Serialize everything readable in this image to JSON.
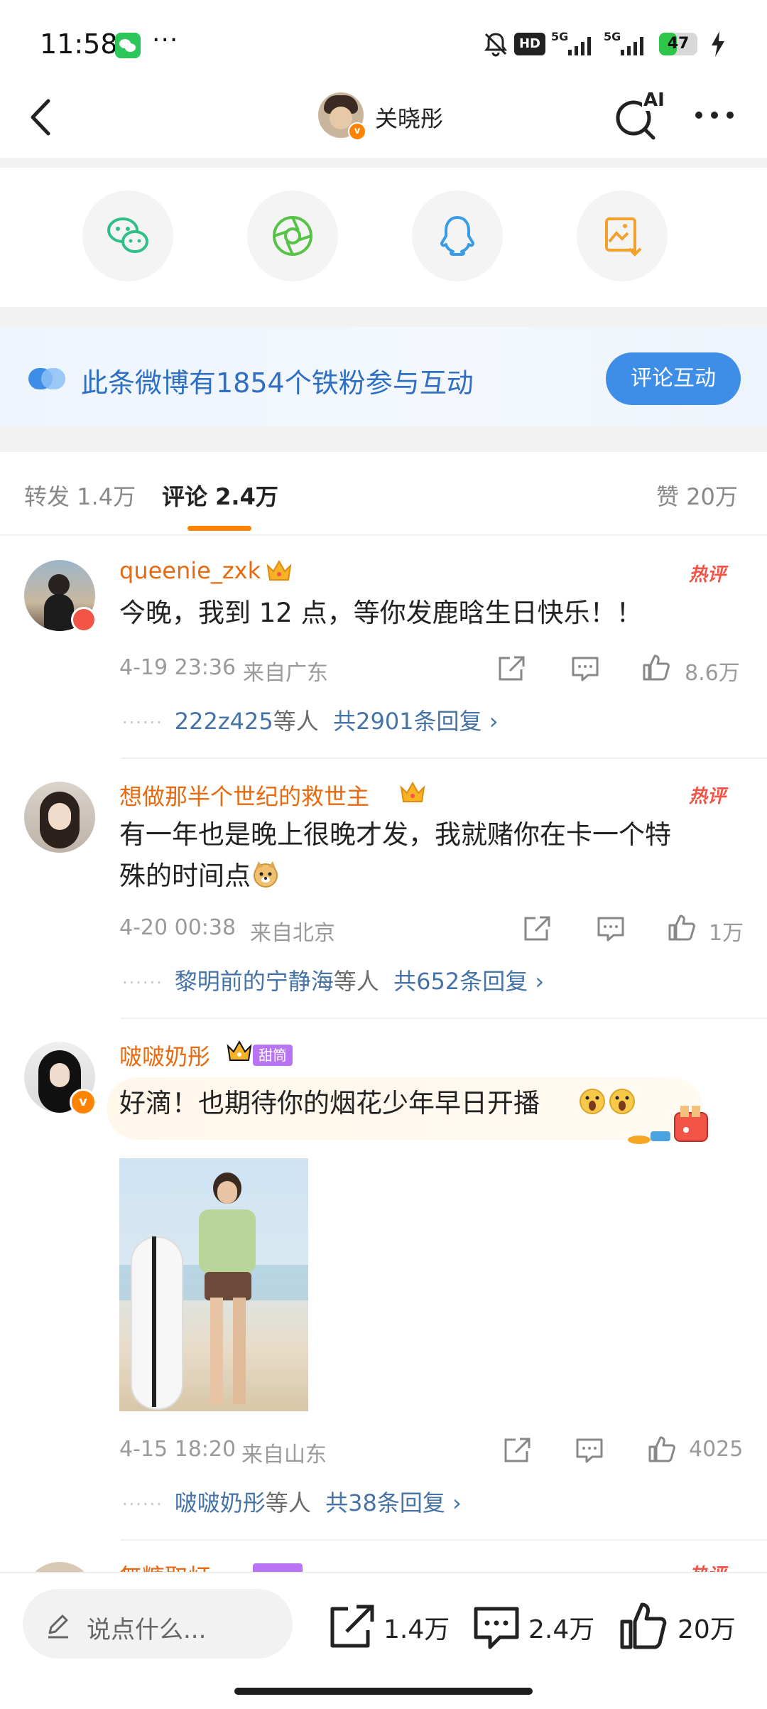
{
  "status_bar": {
    "time": "11:58",
    "more": "···",
    "hd": "HD",
    "signal_1": "5G",
    "signal_2": "5G",
    "battery_level": 47,
    "battery_text": "47"
  },
  "header": {
    "title": "关晓彤",
    "ai_label": "AI"
  },
  "share": {
    "icons": [
      "wechat-icon",
      "moments-icon",
      "qq-icon",
      "save-image-icon"
    ]
  },
  "banner": {
    "text": "此条微博有1854个铁粉参与互动",
    "button": "评论互动"
  },
  "tabs": {
    "repost": "转发 1.4万",
    "comment": "评论 2.4万",
    "like": "赞 20万"
  },
  "comments": [
    {
      "user": "queenie_zxk",
      "hot": "热评",
      "text": "今晚，我到 12 点，等你发鹿晗生日快乐！！",
      "time": "4-19 23:36",
      "location": "来自广东",
      "likes": "8.6万",
      "reply_users": "222z425",
      "reply_mid": "等人",
      "reply_total": "共2901条回复 ›"
    },
    {
      "user": "想做那半个世纪的救世主",
      "hot": "热评",
      "text_line1": "有一年也是晚上很晚才发，我就赌你在卡一个特",
      "text_line2": "殊的时间点",
      "time": "4-20 00:38",
      "location": "来自北京",
      "likes": "1万",
      "reply_users": "黎明前的宁静海",
      "reply_mid": "等人",
      "reply_total": "共652条回复 ›"
    },
    {
      "user": "啵啵奶彤",
      "fan_badge": "甜筒",
      "text": "好滴！也期待你的烟花少年早日开播",
      "time": "4-15 18:20",
      "location": "来自山东",
      "likes": "4025",
      "reply_users": "啵啵奶彤",
      "reply_mid": "等人",
      "reply_total": "共38条回复 ›"
    },
    {
      "user": "無糖取灯",
      "hot": "热评"
    }
  ],
  "bottom_bar": {
    "placeholder": "说点什么...",
    "reposts": "1.4万",
    "comments": "2.4万",
    "likes": "20万"
  },
  "colors": {
    "accent": "#ff8200",
    "link_blue": "#4673a6",
    "banner_blue": "#3e8ee8",
    "hot_red": "#f25547",
    "username_orange": "#e86a10"
  }
}
